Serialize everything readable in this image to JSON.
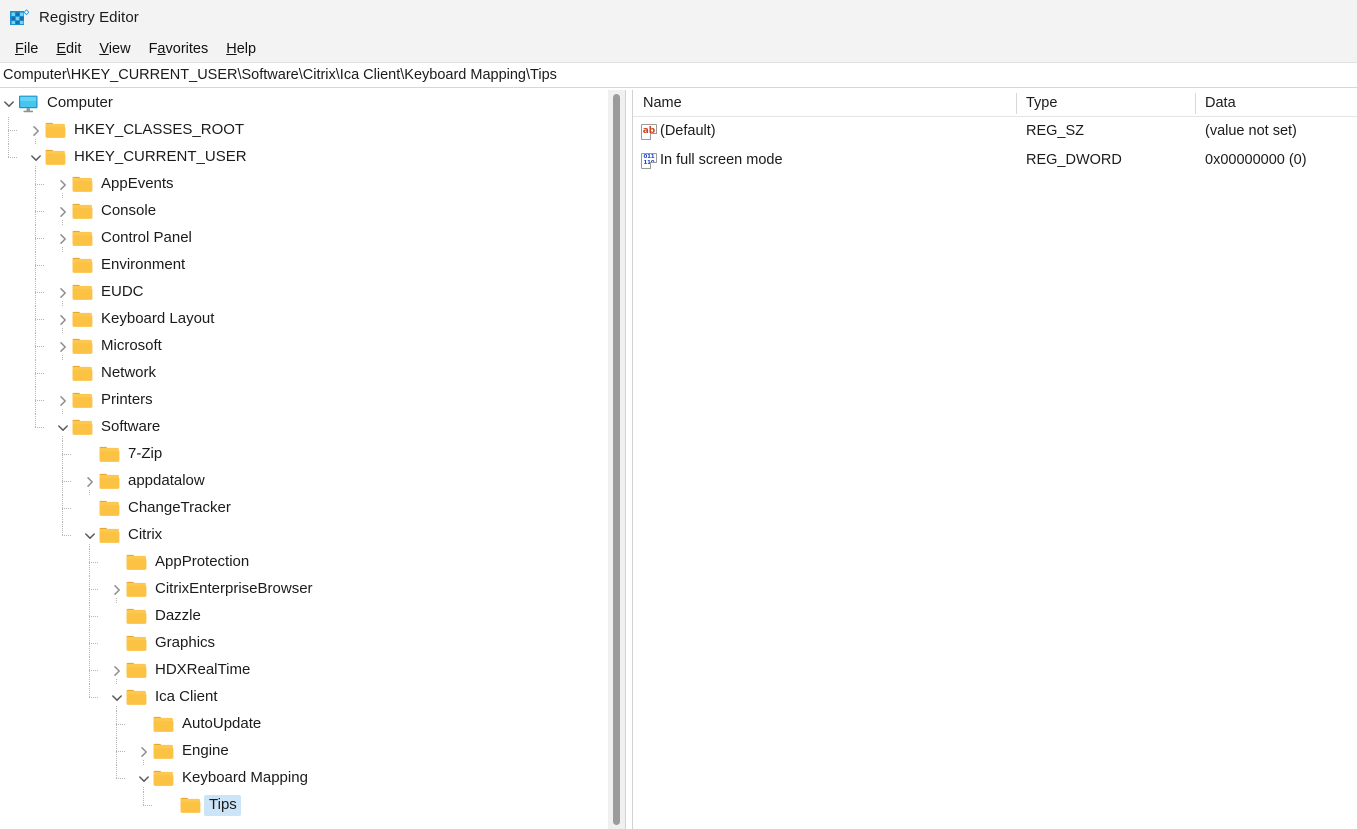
{
  "window": {
    "title": "Registry Editor",
    "icon": "registry-editor-icon"
  },
  "menu": {
    "items": [
      {
        "label": "File",
        "accel": "F"
      },
      {
        "label": "Edit",
        "accel": "E"
      },
      {
        "label": "View",
        "accel": "V"
      },
      {
        "label": "Favorites",
        "accel": "a"
      },
      {
        "label": "Help",
        "accel": "H"
      }
    ]
  },
  "address": {
    "path": "Computer\\HKEY_CURRENT_USER\\Software\\Citrix\\Ica Client\\Keyboard Mapping\\Tips"
  },
  "tree": {
    "nodes": [
      {
        "label": "Computer",
        "depth": 0,
        "icon": "computer-icon",
        "twisty": "expanded",
        "selected": false
      },
      {
        "label": "HKEY_CLASSES_ROOT",
        "depth": 1,
        "icon": "folder-icon",
        "twisty": "collapsed",
        "selected": false
      },
      {
        "label": "HKEY_CURRENT_USER",
        "depth": 1,
        "icon": "folder-icon",
        "twisty": "expanded",
        "selected": false
      },
      {
        "label": "AppEvents",
        "depth": 2,
        "icon": "folder-icon",
        "twisty": "collapsed",
        "selected": false
      },
      {
        "label": "Console",
        "depth": 2,
        "icon": "folder-icon",
        "twisty": "collapsed",
        "selected": false
      },
      {
        "label": "Control Panel",
        "depth": 2,
        "icon": "folder-icon",
        "twisty": "collapsed",
        "selected": false
      },
      {
        "label": "Environment",
        "depth": 2,
        "icon": "folder-icon",
        "twisty": "leaf",
        "selected": false
      },
      {
        "label": "EUDC",
        "depth": 2,
        "icon": "folder-icon",
        "twisty": "collapsed",
        "selected": false
      },
      {
        "label": "Keyboard Layout",
        "depth": 2,
        "icon": "folder-icon",
        "twisty": "collapsed",
        "selected": false
      },
      {
        "label": "Microsoft",
        "depth": 2,
        "icon": "folder-icon",
        "twisty": "collapsed",
        "selected": false
      },
      {
        "label": "Network",
        "depth": 2,
        "icon": "folder-icon",
        "twisty": "leaf",
        "selected": false
      },
      {
        "label": "Printers",
        "depth": 2,
        "icon": "folder-icon",
        "twisty": "collapsed",
        "selected": false
      },
      {
        "label": "Software",
        "depth": 2,
        "icon": "folder-icon",
        "twisty": "expanded",
        "selected": false
      },
      {
        "label": "7-Zip",
        "depth": 3,
        "icon": "folder-icon",
        "twisty": "leaf",
        "selected": false
      },
      {
        "label": "appdatalow",
        "depth": 3,
        "icon": "folder-icon",
        "twisty": "collapsed",
        "selected": false
      },
      {
        "label": "ChangeTracker",
        "depth": 3,
        "icon": "folder-icon",
        "twisty": "leaf",
        "selected": false
      },
      {
        "label": "Citrix",
        "depth": 3,
        "icon": "folder-icon",
        "twisty": "expanded",
        "selected": false
      },
      {
        "label": "AppProtection",
        "depth": 4,
        "icon": "folder-icon",
        "twisty": "leaf",
        "selected": false
      },
      {
        "label": "CitrixEnterpriseBrowser",
        "depth": 4,
        "icon": "folder-icon",
        "twisty": "collapsed",
        "selected": false
      },
      {
        "label": "Dazzle",
        "depth": 4,
        "icon": "folder-icon",
        "twisty": "leaf",
        "selected": false
      },
      {
        "label": "Graphics",
        "depth": 4,
        "icon": "folder-icon",
        "twisty": "leaf",
        "selected": false
      },
      {
        "label": "HDXRealTime",
        "depth": 4,
        "icon": "folder-icon",
        "twisty": "collapsed",
        "selected": false
      },
      {
        "label": "Ica Client",
        "depth": 4,
        "icon": "folder-icon",
        "twisty": "expanded",
        "selected": false
      },
      {
        "label": "AutoUpdate",
        "depth": 5,
        "icon": "folder-icon",
        "twisty": "leaf",
        "selected": false
      },
      {
        "label": "Engine",
        "depth": 5,
        "icon": "folder-icon",
        "twisty": "collapsed",
        "selected": false
      },
      {
        "label": "Keyboard Mapping",
        "depth": 5,
        "icon": "folder-icon",
        "twisty": "expanded",
        "selected": false
      },
      {
        "label": "Tips",
        "depth": 6,
        "icon": "folder-icon",
        "twisty": "leaf",
        "selected": true
      }
    ]
  },
  "values_list": {
    "columns": [
      "Name",
      "Type",
      "Data"
    ],
    "rows": [
      {
        "icon": "string-value-icon",
        "name": "(Default)",
        "type": "REG_SZ",
        "data": "(value not set)"
      },
      {
        "icon": "dword-value-icon",
        "name": "In full screen mode",
        "type": "REG_DWORD",
        "data": "0x00000000 (0)"
      }
    ]
  },
  "icons": {
    "string_glyph": "ab",
    "dword_glyph_top": "011",
    "dword_glyph_bottom": "110"
  },
  "colors": {
    "selection": "#cce4f7",
    "folder": "#fbc34a",
    "titlebar_bg": "#f3f3f3",
    "string_icon": "#c8441f",
    "dword_icon": "#1f44c8"
  }
}
